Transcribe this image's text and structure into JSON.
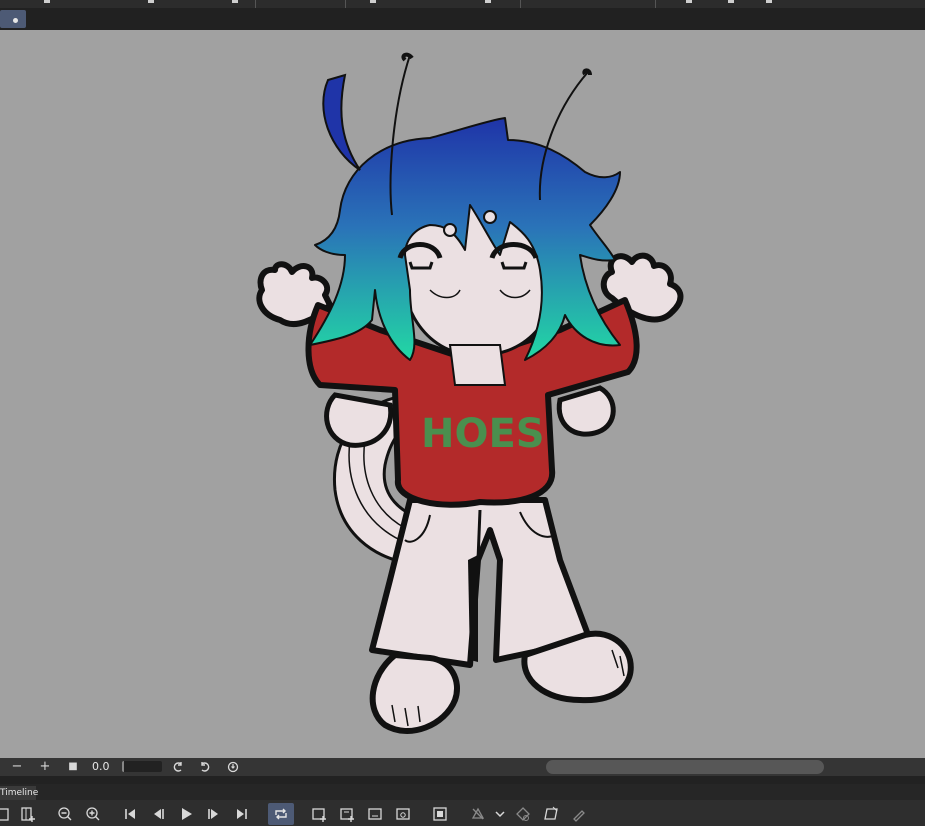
{
  "canvas": {
    "shirt_text": "HOES"
  },
  "controls": {
    "zoom_out": "−",
    "zoom_in": "+",
    "stop": "■",
    "rotation_value": "0.0"
  },
  "timeline": {
    "tab_label": "Timeline"
  },
  "colors": {
    "canvas_bg": "#a1a1a1",
    "panel_bg": "#2e2e2e",
    "accent": "#4d5a75",
    "shirt": "#b32a2a",
    "shirt_text": "#4a8f4e",
    "skin": "#ebe0e2"
  }
}
